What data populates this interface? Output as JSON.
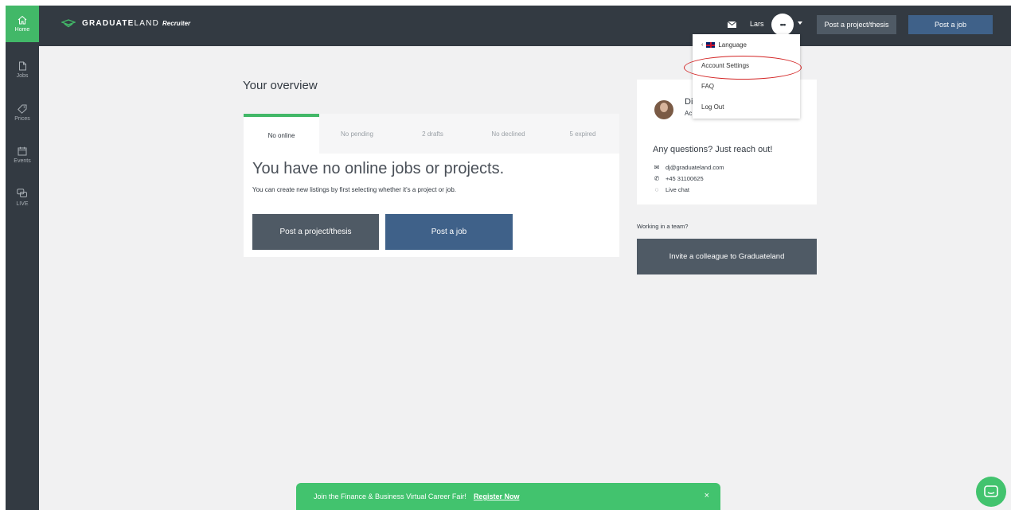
{
  "sidebar": {
    "items": [
      {
        "label": "Home",
        "icon": "home-icon"
      },
      {
        "label": "Jobs",
        "icon": "document-icon"
      },
      {
        "label": "Prices",
        "icon": "tag-icon"
      },
      {
        "label": "Events",
        "icon": "calendar-icon"
      },
      {
        "label": "LIVE",
        "icon": "chat-bubbles-icon"
      }
    ]
  },
  "header": {
    "logo_main": "GRADUATE",
    "logo_light": "LAND",
    "logo_sub": "Recruiter",
    "user_name": "Lars",
    "avatar_text": "•••",
    "post_project_label": "Post a project/thesis",
    "post_job_label": "Post a job"
  },
  "dropdown": {
    "language": "Language",
    "account_settings": "Account Settings",
    "faq": "FAQ",
    "logout": "Log Out"
  },
  "overview": {
    "title": "Your overview",
    "tabs": [
      "No online",
      "No pending",
      "2 drafts",
      "No declined",
      "5 expired"
    ],
    "heading": "You have no online jobs or projects.",
    "subtext": "You can create new listings by first selecting whether it's a project or job.",
    "post_project_label": "Post a project/thesis",
    "post_job_label": "Post a job"
  },
  "contact": {
    "name": "Di",
    "role": "Ac",
    "question": "Any questions? Just reach out!",
    "email": "dj@graduateland.com",
    "phone": "+45 31100625",
    "chat": "Live chat"
  },
  "team": {
    "label": "Working in a team?",
    "invite_label": "Invite a colleague to Graduateland"
  },
  "banner": {
    "text": "Join the Finance & Business Virtual Career Fair!",
    "link": "Register Now",
    "close": "×"
  },
  "colors": {
    "sidebar_bg": "#333a42",
    "accent_green": "#42b868",
    "button_blue": "#3f6189",
    "button_gray": "#4f5a65",
    "highlight_red": "#d32525"
  }
}
